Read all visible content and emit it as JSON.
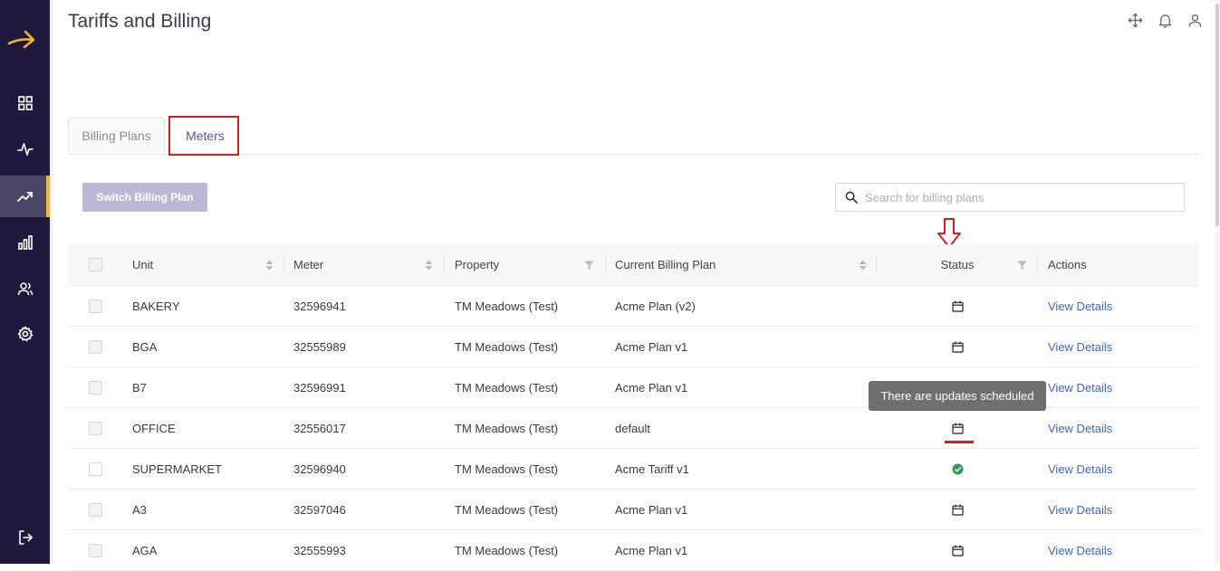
{
  "page": {
    "title": "Tariffs and Billing"
  },
  "sidebar": {
    "items": [
      {
        "icon": "dashboard-grid-icon",
        "active": false
      },
      {
        "icon": "activity-pulse-icon",
        "active": false
      },
      {
        "icon": "trending-up-icon",
        "active": true
      },
      {
        "icon": "bar-chart-icon",
        "active": false
      },
      {
        "icon": "users-icon",
        "active": false
      },
      {
        "icon": "gear-icon",
        "active": false
      }
    ],
    "bottom_icon": "logout-icon",
    "accent_color": "#f2b632",
    "background_color": "#1f1a3d"
  },
  "header": {
    "icons": [
      "move-arrows-icon",
      "bell-icon",
      "user-icon"
    ]
  },
  "tabs": [
    {
      "label": "Billing Plans",
      "active": false
    },
    {
      "label": "Meters",
      "active": true
    }
  ],
  "toolbar": {
    "switch_label": "Switch Billing Plan",
    "search_placeholder": "Search for billing plans"
  },
  "table": {
    "columns": {
      "unit": "Unit",
      "meter": "Meter",
      "property": "Property",
      "plan": "Current Billing Plan",
      "status": "Status",
      "actions": "Actions"
    },
    "rows": [
      {
        "unit": "BAKERY",
        "meter": "32596941",
        "property": "TM Meadows (Test)",
        "plan": "Acme Plan (v2)",
        "status": "scheduled",
        "action": "View Details"
      },
      {
        "unit": "BGA",
        "meter": "32555989",
        "property": "TM Meadows (Test)",
        "plan": "Acme Plan v1",
        "status": "scheduled",
        "action": "View Details"
      },
      {
        "unit": "B7",
        "meter": "32596991",
        "property": "TM Meadows (Test)",
        "plan": "Acme Plan v1",
        "status": "scheduled",
        "action": "View Details"
      },
      {
        "unit": "OFFICE",
        "meter": "32556017",
        "property": "TM Meadows (Test)",
        "plan": "default",
        "status": "scheduled",
        "action": "View Details"
      },
      {
        "unit": "SUPERMARKET",
        "meter": "32596940",
        "property": "TM Meadows (Test)",
        "plan": "Acme Tariff v1",
        "status": "ok",
        "action": "View Details"
      },
      {
        "unit": "A3",
        "meter": "32597046",
        "property": "TM Meadows (Test)",
        "plan": "Acme Plan v1",
        "status": "scheduled",
        "action": "View Details"
      },
      {
        "unit": "AGA",
        "meter": "32555993",
        "property": "TM Meadows (Test)",
        "plan": "Acme Plan v1",
        "status": "scheduled",
        "action": "View Details"
      }
    ]
  },
  "tooltip": {
    "text": "There are updates scheduled"
  },
  "colors": {
    "link": "#3d64c8",
    "highlight_red": "#d21f26",
    "ok_green": "#2e9e4f",
    "button_disabled": "#bdb7d6"
  }
}
